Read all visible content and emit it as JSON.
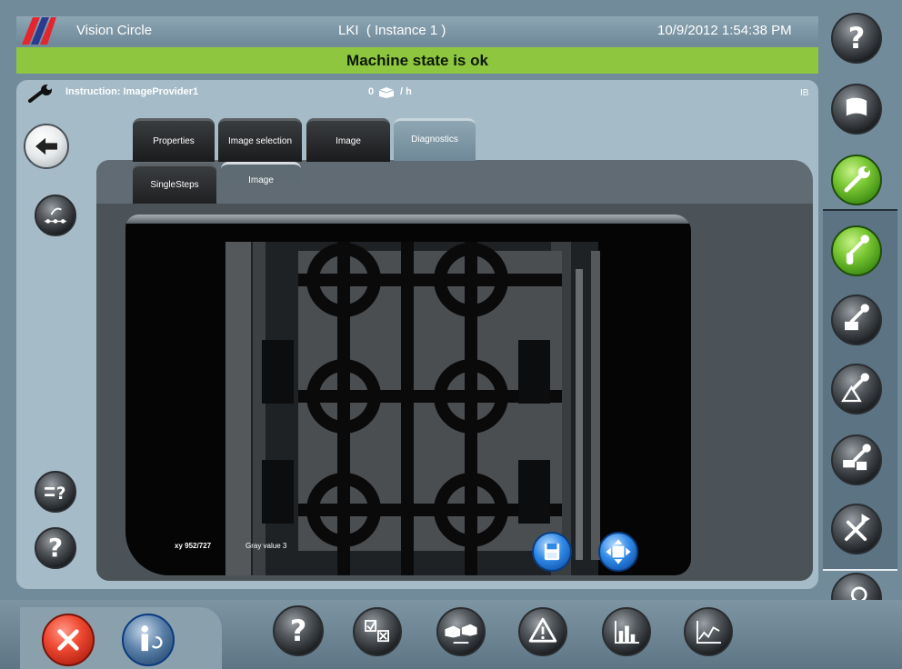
{
  "header": {
    "app_name": "Vision Circle",
    "instance": "LKI  ( Instance 1 )",
    "datetime": "10/9/2012 1:54:38 PM"
  },
  "status": {
    "message": "Machine state is ok",
    "color": "#8ec63f"
  },
  "instruction": {
    "label": "Instruction: ImageProvider1",
    "rate_value": "0",
    "rate_unit": "/ h",
    "code": "IB"
  },
  "tabs": [
    {
      "label": "Properties",
      "active": false
    },
    {
      "label": "Image selection",
      "active": false
    },
    {
      "label": "Image",
      "active": false
    },
    {
      "label": "Diagnostics",
      "active": true
    }
  ],
  "subtabs": [
    {
      "label": "SingleSteps",
      "active": false
    },
    {
      "label": "Image",
      "active": true
    }
  ],
  "viewer": {
    "coords": "xy 952/727",
    "gray_value": "Gray value 3"
  },
  "icons": {
    "left": [
      "back-arrow-icon",
      "workflow-icon",
      "help-settings-icon",
      "help-icon"
    ],
    "right": [
      "help-icon",
      "flag-icon",
      "wrench-icon",
      "wrench-bottle-icon",
      "wrench-module-icon",
      "wrench-warning-icon",
      "wrench-printer-icon",
      "tools-icon",
      "search-icon"
    ],
    "bottom": [
      "close-icon",
      "user-logout-icon",
      "help-icon",
      "checklist-icon",
      "exchange-icon",
      "warning-icon",
      "bar-chart-icon",
      "line-chart-icon"
    ],
    "viewer": [
      "save-icon",
      "fit-view-icon"
    ]
  },
  "help_glyph": "?"
}
